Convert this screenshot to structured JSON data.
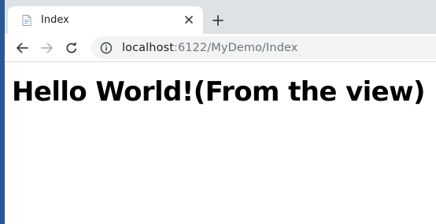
{
  "browser": {
    "tab": {
      "title": "Index",
      "favicon": "page-icon"
    },
    "new_tab_icon": "plus-icon",
    "toolbar": {
      "back_icon": "back-arrow-icon",
      "forward_icon": "forward-arrow-icon",
      "reload_icon": "reload-icon",
      "info_icon": "info-icon"
    },
    "address": {
      "host": "localhost",
      "rest": ":6122/MyDemo/Index"
    }
  },
  "page": {
    "heading": "Hello World!(From the view)"
  },
  "colors": {
    "tabstrip": "#dee1e6",
    "omnibox": "#f1f3f4",
    "url_host": "#202124",
    "url_rest": "#70757a",
    "window_edge": "#2b5797"
  }
}
